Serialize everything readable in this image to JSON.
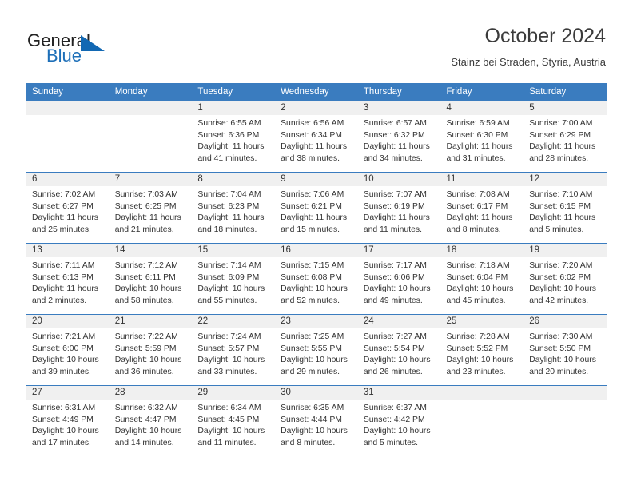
{
  "brand": {
    "name_part1": "General",
    "name_part2": "Blue",
    "accent_color": "#1268b3"
  },
  "header": {
    "title": "October 2024",
    "subtitle": "Stainz bei Straden, Styria, Austria"
  },
  "theme": {
    "header_blue": "#3a7cbf",
    "daynum_band": "#f0f0f0",
    "text": "#333333"
  },
  "weekdays": [
    "Sunday",
    "Monday",
    "Tuesday",
    "Wednesday",
    "Thursday",
    "Friday",
    "Saturday"
  ],
  "weeks": [
    [
      {
        "day": "",
        "sunrise": "",
        "sunset": "",
        "daylight": "",
        "empty": true
      },
      {
        "day": "",
        "sunrise": "",
        "sunset": "",
        "daylight": "",
        "empty": true
      },
      {
        "day": "1",
        "sunrise": "Sunrise: 6:55 AM",
        "sunset": "Sunset: 6:36 PM",
        "daylight": "Daylight: 11 hours and 41 minutes."
      },
      {
        "day": "2",
        "sunrise": "Sunrise: 6:56 AM",
        "sunset": "Sunset: 6:34 PM",
        "daylight": "Daylight: 11 hours and 38 minutes."
      },
      {
        "day": "3",
        "sunrise": "Sunrise: 6:57 AM",
        "sunset": "Sunset: 6:32 PM",
        "daylight": "Daylight: 11 hours and 34 minutes."
      },
      {
        "day": "4",
        "sunrise": "Sunrise: 6:59 AM",
        "sunset": "Sunset: 6:30 PM",
        "daylight": "Daylight: 11 hours and 31 minutes."
      },
      {
        "day": "5",
        "sunrise": "Sunrise: 7:00 AM",
        "sunset": "Sunset: 6:29 PM",
        "daylight": "Daylight: 11 hours and 28 minutes."
      }
    ],
    [
      {
        "day": "6",
        "sunrise": "Sunrise: 7:02 AM",
        "sunset": "Sunset: 6:27 PM",
        "daylight": "Daylight: 11 hours and 25 minutes."
      },
      {
        "day": "7",
        "sunrise": "Sunrise: 7:03 AM",
        "sunset": "Sunset: 6:25 PM",
        "daylight": "Daylight: 11 hours and 21 minutes."
      },
      {
        "day": "8",
        "sunrise": "Sunrise: 7:04 AM",
        "sunset": "Sunset: 6:23 PM",
        "daylight": "Daylight: 11 hours and 18 minutes."
      },
      {
        "day": "9",
        "sunrise": "Sunrise: 7:06 AM",
        "sunset": "Sunset: 6:21 PM",
        "daylight": "Daylight: 11 hours and 15 minutes."
      },
      {
        "day": "10",
        "sunrise": "Sunrise: 7:07 AM",
        "sunset": "Sunset: 6:19 PM",
        "daylight": "Daylight: 11 hours and 11 minutes."
      },
      {
        "day": "11",
        "sunrise": "Sunrise: 7:08 AM",
        "sunset": "Sunset: 6:17 PM",
        "daylight": "Daylight: 11 hours and 8 minutes."
      },
      {
        "day": "12",
        "sunrise": "Sunrise: 7:10 AM",
        "sunset": "Sunset: 6:15 PM",
        "daylight": "Daylight: 11 hours and 5 minutes."
      }
    ],
    [
      {
        "day": "13",
        "sunrise": "Sunrise: 7:11 AM",
        "sunset": "Sunset: 6:13 PM",
        "daylight": "Daylight: 11 hours and 2 minutes."
      },
      {
        "day": "14",
        "sunrise": "Sunrise: 7:12 AM",
        "sunset": "Sunset: 6:11 PM",
        "daylight": "Daylight: 10 hours and 58 minutes."
      },
      {
        "day": "15",
        "sunrise": "Sunrise: 7:14 AM",
        "sunset": "Sunset: 6:09 PM",
        "daylight": "Daylight: 10 hours and 55 minutes."
      },
      {
        "day": "16",
        "sunrise": "Sunrise: 7:15 AM",
        "sunset": "Sunset: 6:08 PM",
        "daylight": "Daylight: 10 hours and 52 minutes."
      },
      {
        "day": "17",
        "sunrise": "Sunrise: 7:17 AM",
        "sunset": "Sunset: 6:06 PM",
        "daylight": "Daylight: 10 hours and 49 minutes."
      },
      {
        "day": "18",
        "sunrise": "Sunrise: 7:18 AM",
        "sunset": "Sunset: 6:04 PM",
        "daylight": "Daylight: 10 hours and 45 minutes."
      },
      {
        "day": "19",
        "sunrise": "Sunrise: 7:20 AM",
        "sunset": "Sunset: 6:02 PM",
        "daylight": "Daylight: 10 hours and 42 minutes."
      }
    ],
    [
      {
        "day": "20",
        "sunrise": "Sunrise: 7:21 AM",
        "sunset": "Sunset: 6:00 PM",
        "daylight": "Daylight: 10 hours and 39 minutes."
      },
      {
        "day": "21",
        "sunrise": "Sunrise: 7:22 AM",
        "sunset": "Sunset: 5:59 PM",
        "daylight": "Daylight: 10 hours and 36 minutes."
      },
      {
        "day": "22",
        "sunrise": "Sunrise: 7:24 AM",
        "sunset": "Sunset: 5:57 PM",
        "daylight": "Daylight: 10 hours and 33 minutes."
      },
      {
        "day": "23",
        "sunrise": "Sunrise: 7:25 AM",
        "sunset": "Sunset: 5:55 PM",
        "daylight": "Daylight: 10 hours and 29 minutes."
      },
      {
        "day": "24",
        "sunrise": "Sunrise: 7:27 AM",
        "sunset": "Sunset: 5:54 PM",
        "daylight": "Daylight: 10 hours and 26 minutes."
      },
      {
        "day": "25",
        "sunrise": "Sunrise: 7:28 AM",
        "sunset": "Sunset: 5:52 PM",
        "daylight": "Daylight: 10 hours and 23 minutes."
      },
      {
        "day": "26",
        "sunrise": "Sunrise: 7:30 AM",
        "sunset": "Sunset: 5:50 PM",
        "daylight": "Daylight: 10 hours and 20 minutes."
      }
    ],
    [
      {
        "day": "27",
        "sunrise": "Sunrise: 6:31 AM",
        "sunset": "Sunset: 4:49 PM",
        "daylight": "Daylight: 10 hours and 17 minutes."
      },
      {
        "day": "28",
        "sunrise": "Sunrise: 6:32 AM",
        "sunset": "Sunset: 4:47 PM",
        "daylight": "Daylight: 10 hours and 14 minutes."
      },
      {
        "day": "29",
        "sunrise": "Sunrise: 6:34 AM",
        "sunset": "Sunset: 4:45 PM",
        "daylight": "Daylight: 10 hours and 11 minutes."
      },
      {
        "day": "30",
        "sunrise": "Sunrise: 6:35 AM",
        "sunset": "Sunset: 4:44 PM",
        "daylight": "Daylight: 10 hours and 8 minutes."
      },
      {
        "day": "31",
        "sunrise": "Sunrise: 6:37 AM",
        "sunset": "Sunset: 4:42 PM",
        "daylight": "Daylight: 10 hours and 5 minutes."
      },
      {
        "day": "",
        "sunrise": "",
        "sunset": "",
        "daylight": "",
        "empty": true
      },
      {
        "day": "",
        "sunrise": "",
        "sunset": "",
        "daylight": "",
        "empty": true
      }
    ]
  ]
}
